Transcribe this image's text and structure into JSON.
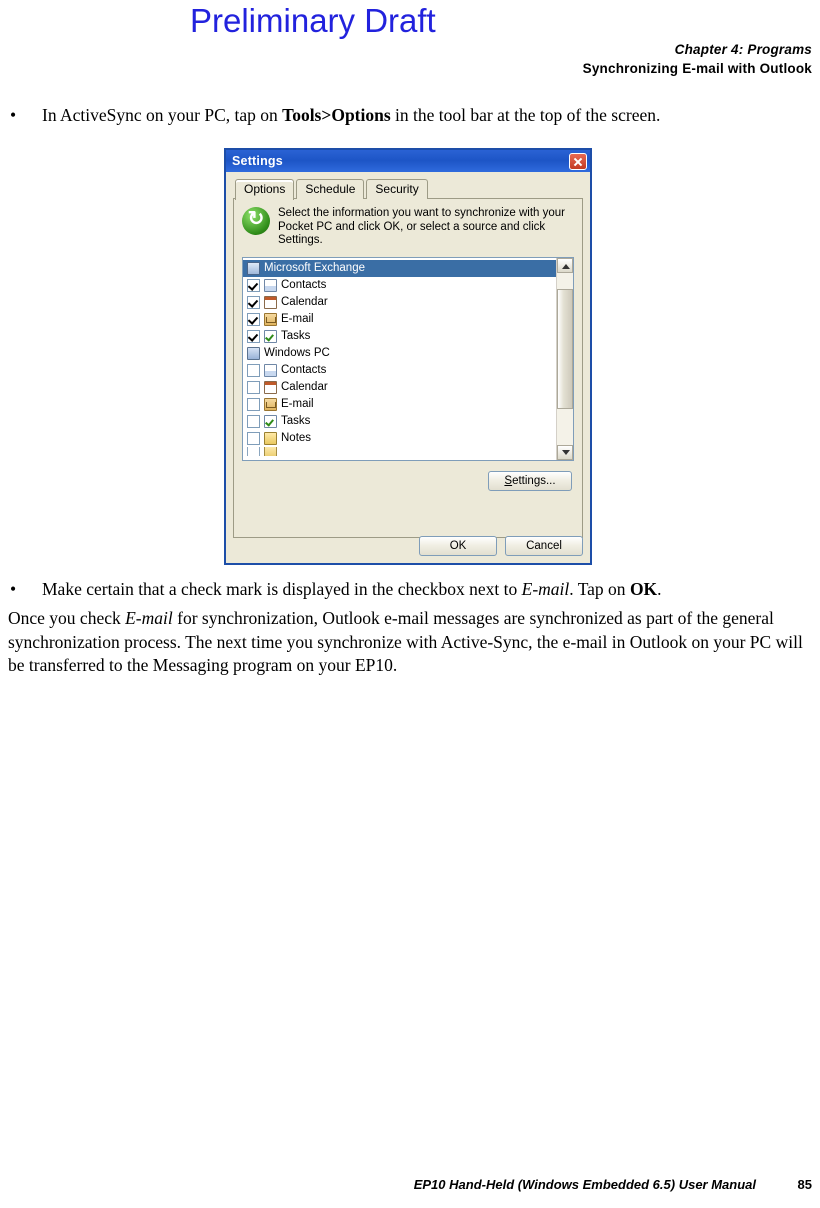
{
  "watermark": "Preliminary Draft",
  "header": {
    "chapter": "Chapter 4: Programs",
    "subtitle": "Synchronizing E-mail with Outlook"
  },
  "bullets": [
    {
      "mark": "•",
      "parts": [
        {
          "t": "In ActiveSync on your PC, tap on ",
          "s": "normal"
        },
        {
          "t": "Tools>Options",
          "s": "bold"
        },
        {
          "t": " in the tool bar at the top of the screen.",
          "s": "normal"
        }
      ]
    },
    {
      "mark": "•",
      "parts": [
        {
          "t": "Make certain that a check mark is displayed in the checkbox next to ",
          "s": "normal"
        },
        {
          "t": "E-mail",
          "s": "italic"
        },
        {
          "t": ". Tap on ",
          "s": "normal"
        },
        {
          "t": "OK",
          "s": "bold"
        },
        {
          "t": ".",
          "s": "normal"
        }
      ]
    }
  ],
  "paragraph": {
    "parts": [
      {
        "t": "Once you check ",
        "s": "normal"
      },
      {
        "t": "E-mail",
        "s": "italic"
      },
      {
        "t": " for synchronization, Outlook e-mail messages are synchronized as part of the general synchronization process. The next time you synchronize with Active-Sync, the e-mail in Outlook on your PC will be transferred to the Messaging program on your EP10.",
        "s": "normal"
      }
    ]
  },
  "dialog": {
    "title": "Settings",
    "close_icon": "close-icon",
    "tabs": [
      {
        "label": "Options",
        "active": true
      },
      {
        "label": "Schedule",
        "active": false
      },
      {
        "label": "Security",
        "active": false
      }
    ],
    "info_text": "Select the information you want to synchronize with your Pocket PC and click OK, or select a source and click Settings.",
    "list": [
      {
        "label": "Microsoft Exchange",
        "type": "group",
        "icon": "exchange-icon",
        "selected": true,
        "checkbox": null
      },
      {
        "label": "Contacts",
        "type": "item",
        "icon": "contacts-icon",
        "checkbox": "checked"
      },
      {
        "label": "Calendar",
        "type": "item",
        "icon": "calendar-icon",
        "checkbox": "checked"
      },
      {
        "label": "E-mail",
        "type": "item",
        "icon": "email-icon",
        "checkbox": "checked"
      },
      {
        "label": "Tasks",
        "type": "item",
        "icon": "tasks-icon",
        "checkbox": "checked"
      },
      {
        "label": "Windows PC",
        "type": "group",
        "icon": "pc-icon",
        "selected": false,
        "checkbox": null
      },
      {
        "label": "Contacts",
        "type": "item",
        "icon": "contacts-icon",
        "checkbox": "unchecked"
      },
      {
        "label": "Calendar",
        "type": "item",
        "icon": "calendar-icon",
        "checkbox": "unchecked"
      },
      {
        "label": "E-mail",
        "type": "item",
        "icon": "email-icon",
        "checkbox": "unchecked"
      },
      {
        "label": "Tasks",
        "type": "item",
        "icon": "tasks-icon",
        "checkbox": "unchecked"
      },
      {
        "label": "Notes",
        "type": "item",
        "icon": "notes-icon",
        "checkbox": "unchecked"
      }
    ],
    "settings_button": "Settings...",
    "settings_button_pre": "S",
    "settings_button_post": "ettings...",
    "ok_button": "OK",
    "cancel_button": "Cancel"
  },
  "footer": {
    "text": "EP10 Hand-Held (Windows Embedded 6.5) User Manual",
    "page": "85"
  }
}
